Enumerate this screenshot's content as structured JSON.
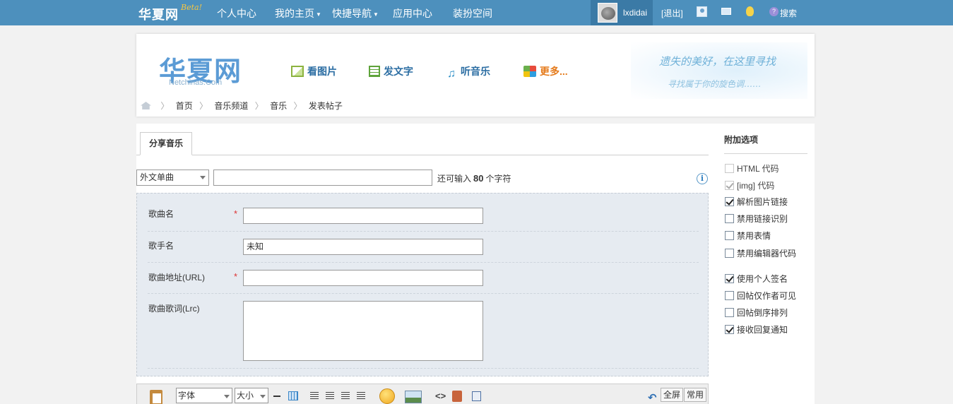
{
  "topbar": {
    "logo": "华夏网",
    "beta": "Beta!",
    "nav": [
      "个人中心",
      "我的主页",
      "快捷导航",
      "应用中心",
      "装扮空间"
    ],
    "username": "lxdidai",
    "logout": "[退出]",
    "search": "搜索"
  },
  "header": {
    "logo": "华夏网",
    "logo_sub": "Netchinas.Com",
    "categories": [
      "看图片",
      "发文字",
      "听音乐",
      "更多..."
    ],
    "banner_line1": "遗失的美好，在这里寻找",
    "banner_line2": "寻找属于你的旋色调……",
    "breadcrumb": [
      "首页",
      "音乐频道",
      "音乐",
      "发表帖子"
    ]
  },
  "form": {
    "tab": "分享音乐",
    "type_select": "外文单曲",
    "subject_value": "",
    "char_count_prefix": "还可输入",
    "char_count_value": "80",
    "char_count_suffix": "个字符",
    "fields": {
      "song_name_label": "歌曲名",
      "singer_label": "歌手名",
      "singer_value": "未知",
      "url_label": "歌曲地址(URL)",
      "lyrics_label": "歌曲歌词(Lrc)",
      "required_mark": "*"
    }
  },
  "toolbar": {
    "font": "字体",
    "size": "大小",
    "fullscreen": "全屏",
    "common": "常用"
  },
  "options": {
    "title": "附加选项",
    "items": [
      {
        "label": "HTML 代码",
        "checked": false,
        "disabled": true
      },
      {
        "label": "[img] 代码",
        "checked": true,
        "disabled": true
      },
      {
        "label": "解析图片链接",
        "checked": true,
        "disabled": false
      },
      {
        "label": "禁用链接识别",
        "checked": false,
        "disabled": false
      },
      {
        "label": "禁用表情",
        "checked": false,
        "disabled": false
      },
      {
        "label": "禁用编辑器代码",
        "checked": false,
        "disabled": false
      },
      {
        "label": "使用个人签名",
        "checked": true,
        "disabled": false
      },
      {
        "label": "回帖仅作者可见",
        "checked": false,
        "disabled": false
      },
      {
        "label": "回帖倒序排列",
        "checked": false,
        "disabled": false
      },
      {
        "label": "接收回复通知",
        "checked": true,
        "disabled": false
      }
    ]
  }
}
